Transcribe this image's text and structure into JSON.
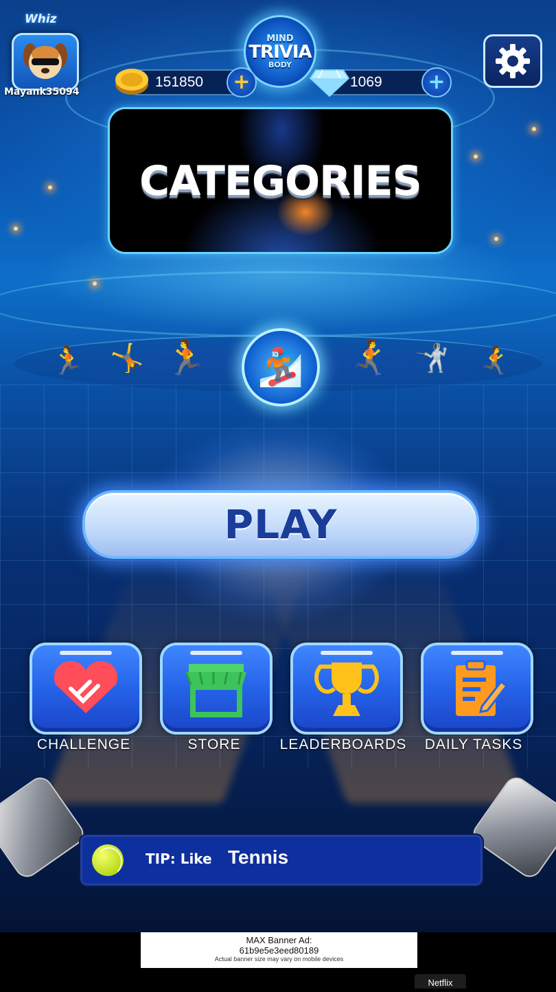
{
  "header": {
    "brand": "Whiz",
    "username": "Mayank35094",
    "logo": {
      "line1": "MIND",
      "line2": "TRIVIA",
      "line3": "BODY"
    },
    "coins": "151850",
    "gems": "1069",
    "avatar_icon": "dog-with-sunglasses-icon",
    "coin_icon": "gold-coin-icon",
    "gem_icon": "diamond-icon",
    "settings_icon": "gear-icon"
  },
  "categories": {
    "title": "CATEGORIES"
  },
  "sports_icons": [
    "runner-icon",
    "gymnast-icon",
    "sprinter-icon",
    "snowboarder-icon",
    "sprinter-icon",
    "dancer-icon",
    "runner-icon"
  ],
  "play": {
    "label": "PLAY"
  },
  "menu": [
    {
      "label": "CHALLENGE",
      "icon": "handshake-heart-icon"
    },
    {
      "label": "STORE",
      "icon": "storefront-icon"
    },
    {
      "label": "LEADERBOARDS",
      "icon": "trophy-icon"
    },
    {
      "label": "DAILY TASKS",
      "icon": "clipboard-icon"
    }
  ],
  "tip": {
    "prefix": "TIP: Like",
    "word": "Tennis",
    "icon": "tennis-ball-icon"
  },
  "ad": {
    "line1": "MAX Banner Ad:",
    "line2": "61b9e5e3eed80189",
    "line3": "Actual banner size may vary on mobile devices"
  },
  "netflix_label": "Netflix",
  "colors": {
    "accent": "#2563e8",
    "play_text": "#1a3d9a",
    "tip_bg": "#0e2f9e"
  }
}
